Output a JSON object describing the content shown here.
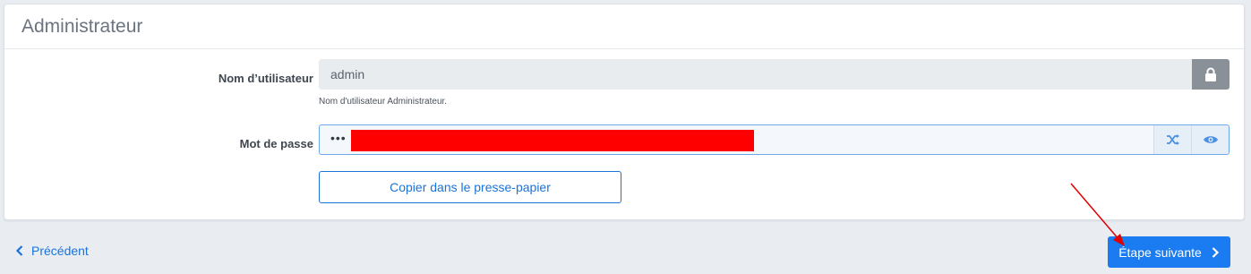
{
  "card": {
    "title": "Administrateur"
  },
  "username": {
    "label": "Nom d’utilisateur",
    "value": "admin",
    "help": "Nom d'utilisateur Administrateur.",
    "lock_icon": "lock-icon"
  },
  "password": {
    "label": "Mot de passe",
    "value_dots": "•••",
    "shuffle_icon": "shuffle-icon",
    "eye_icon": "eye-icon"
  },
  "copy_button": {
    "label": "Copier dans le presse-papier"
  },
  "footer": {
    "previous_label": "Précédent",
    "next_label": "Étape suivante"
  },
  "colors": {
    "accent": "#1a7cf0",
    "redaction": "#ff0000",
    "annotation_arrow": "#e00000"
  }
}
